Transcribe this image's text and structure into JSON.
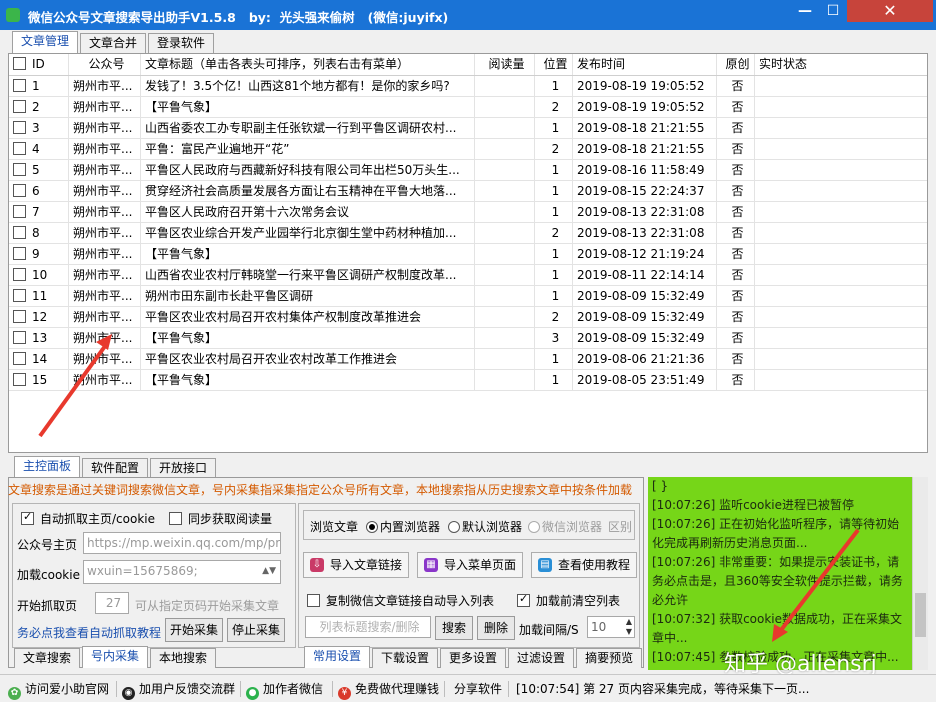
{
  "window": {
    "title": "微信公众号文章搜索导出助手V1.5.8   by:  光头强来偷树   (微信:juyifx)",
    "min_glyph": "—",
    "max_glyph": "☐",
    "close_glyph": "✕"
  },
  "top_tabs": [
    "文章管理",
    "文章合并",
    "登录软件"
  ],
  "table": {
    "columns": [
      "ID",
      "公众号",
      "文章标题（单击各表头可排序，列表右击有菜单）",
      "阅读量",
      "位置",
      "发布时间",
      "原创",
      "实时状态"
    ],
    "rows": [
      {
        "id": "1",
        "account": "朔州市平...",
        "title": "发钱了！3.5个亿！山西这81个地方都有！是你的家乡吗?",
        "reads": "",
        "pos": "1",
        "time": "2019-08-19 19:05:52",
        "original": "否",
        "status": ""
      },
      {
        "id": "2",
        "account": "朔州市平...",
        "title": "【平鲁气象】",
        "reads": "",
        "pos": "2",
        "time": "2019-08-19 19:05:52",
        "original": "否",
        "status": ""
      },
      {
        "id": "3",
        "account": "朔州市平...",
        "title": "山西省委农工办专职副主任张钦斌一行到平鲁区调研农村...",
        "reads": "",
        "pos": "1",
        "time": "2019-08-18 21:21:55",
        "original": "否",
        "status": ""
      },
      {
        "id": "4",
        "account": "朔州市平...",
        "title": "平鲁：富民产业遍地开“花”",
        "reads": "",
        "pos": "2",
        "time": "2019-08-18 21:21:55",
        "original": "否",
        "status": ""
      },
      {
        "id": "5",
        "account": "朔州市平...",
        "title": "平鲁区人民政府与西藏新好科技有限公司年出栏50万头生...",
        "reads": "",
        "pos": "1",
        "time": "2019-08-16 11:58:49",
        "original": "否",
        "status": ""
      },
      {
        "id": "6",
        "account": "朔州市平...",
        "title": "贯穿经济社会高质量发展各方面让右玉精神在平鲁大地落...",
        "reads": "",
        "pos": "1",
        "time": "2019-08-15 22:24:37",
        "original": "否",
        "status": ""
      },
      {
        "id": "7",
        "account": "朔州市平...",
        "title": "平鲁区人民政府召开第十六次常务会议",
        "reads": "",
        "pos": "1",
        "time": "2019-08-13 22:31:08",
        "original": "否",
        "status": ""
      },
      {
        "id": "8",
        "account": "朔州市平...",
        "title": "平鲁区农业综合开发产业园举行北京御生堂中药材种植加...",
        "reads": "",
        "pos": "2",
        "time": "2019-08-13 22:31:08",
        "original": "否",
        "status": ""
      },
      {
        "id": "9",
        "account": "朔州市平...",
        "title": "【平鲁气象】",
        "reads": "",
        "pos": "1",
        "time": "2019-08-12 21:19:24",
        "original": "否",
        "status": ""
      },
      {
        "id": "10",
        "account": "朔州市平...",
        "title": "山西省农业农村厅韩晓堂一行来平鲁区调研产权制度改革...",
        "reads": "",
        "pos": "1",
        "time": "2019-08-11 22:14:14",
        "original": "否",
        "status": ""
      },
      {
        "id": "11",
        "account": "朔州市平...",
        "title": "朔州市田东副市长赴平鲁区调研",
        "reads": "",
        "pos": "1",
        "time": "2019-08-09 15:32:49",
        "original": "否",
        "status": ""
      },
      {
        "id": "12",
        "account": "朔州市平...",
        "title": "平鲁区农业农村局召开农村集体产权制度改革推进会",
        "reads": "",
        "pos": "2",
        "time": "2019-08-09 15:32:49",
        "original": "否",
        "status": ""
      },
      {
        "id": "13",
        "account": "朔州市平...",
        "title": "【平鲁气象】",
        "reads": "",
        "pos": "3",
        "time": "2019-08-09 15:32:49",
        "original": "否",
        "status": ""
      },
      {
        "id": "14",
        "account": "朔州市平...",
        "title": "平鲁区农业农村局召开农业农村改革工作推进会",
        "reads": "",
        "pos": "1",
        "time": "2019-08-06 21:21:36",
        "original": "否",
        "status": ""
      },
      {
        "id": "15",
        "account": "朔州市平...",
        "title": "【平鲁气象】",
        "reads": "",
        "pos": "1",
        "time": "2019-08-05 23:51:49",
        "original": "否",
        "status": ""
      }
    ]
  },
  "bottom_tabs": [
    "主控面板",
    "软件配置",
    "开放接口"
  ],
  "notice": "文章搜索是通过关键词搜索微信文章，号内采集指采集指定公众号所有文章，本地搜索指从历史搜索文章中按条件加载",
  "left_panel": {
    "auto_fetch_label": "自动抓取主页/cookie",
    "sync_reads_label": "同步获取阅读量",
    "homepage_label": "公众号主页",
    "homepage_value": "https://mp.weixin.qq.com/mp/pro",
    "cookie_label": "加载cookie",
    "cookie_value": "wxuin=15675869;",
    "start_page_label": "开始抓取页",
    "start_page_value": "27",
    "start_page_hint": "可从指定页码开始采集文章",
    "tutorial_link": "务必点我查看自动抓取教程",
    "start_button": "开始采集",
    "stop_button": "停止采集",
    "subtabs": [
      "文章搜索",
      "号内采集",
      "本地搜索"
    ]
  },
  "right_panel": {
    "browse_label": "浏览文章",
    "radio_builtin": "内置浏览器",
    "radio_default": "默认浏览器",
    "radio_wechat": "微信浏览器",
    "radio_distinct": "区别",
    "import_links": "导入文章链接",
    "import_menu": "导入菜单页面",
    "view_tutorial": "查看使用教程",
    "copy_links_label": "复制微信文章链接自动导入列表",
    "clear_before_label": "加载前清空列表",
    "title_search_placeholder": "列表标题搜索/删除",
    "search_button": "搜索",
    "delete_button": "删除",
    "interval_label": "加载间隔/S",
    "interval_value": "10",
    "subtabs": [
      "常用设置",
      "下载设置",
      "更多设置",
      "过滤设置",
      "摘要预览"
    ]
  },
  "log": {
    "lines": [
      "[ }",
      "[10:07:26] 监听cookie进程已被暂停",
      "[10:07:26] 正在初始化监听程序，请等待初始化完成再刷新历史消息页面...",
      "[10:07:26] 非常重要：如果提示安装证书，请务必点击是，且360等安全软件提示拦截，请务必允许",
      "[10:07:32] 获取cookie数据成功，正在采集文章中...",
      "[10:07:45] 参数校验成功，正在采集文章中..."
    ]
  },
  "statusbar": {
    "items": [
      "访问爱小助官网",
      "加用户反馈交流群",
      "加作者微信",
      "免费做代理赚钱",
      "分享软件"
    ],
    "message": "[10:07:54] 第 27 页内容采集完成，等待采集下一页..."
  },
  "watermark": "知乎 @allensrj",
  "colors": {
    "titlebar": "#1a73d6",
    "close": "#c7443b",
    "log_bg": "#76d618",
    "notice": "#d45a00",
    "link": "#1a4fae",
    "arrow": "#e8392d"
  }
}
